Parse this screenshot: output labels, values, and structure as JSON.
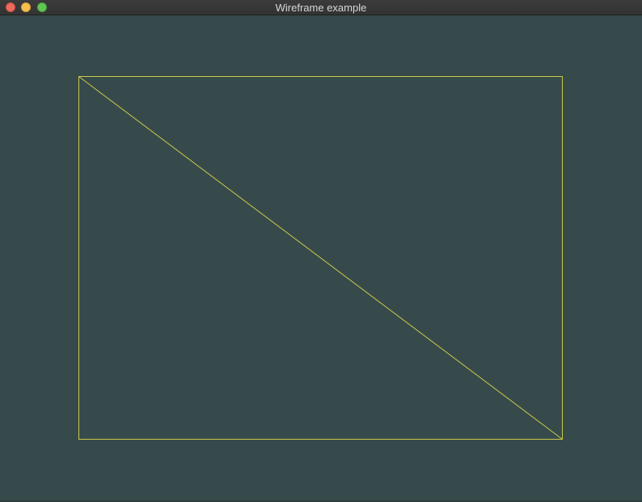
{
  "window": {
    "title": "Wireframe example"
  },
  "colors": {
    "background": "#374a4b",
    "wire": "#c9c94a"
  }
}
